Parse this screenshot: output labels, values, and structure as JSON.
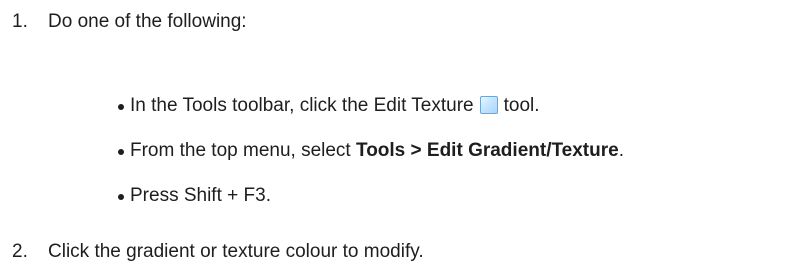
{
  "steps": [
    {
      "number": "1.",
      "text": "Do one of the following:",
      "bullets": [
        {
          "before": "In the Tools toolbar, click the Edit Texture",
          "icon": "edit-texture-tool-icon",
          "after": "tool."
        },
        {
          "before": "From the top menu, select ",
          "strong": "Tools > Edit Gradient/Texture",
          "after": "."
        },
        {
          "text": "Press Shift + F3."
        }
      ]
    },
    {
      "number": "2.",
      "text": "Click the gradient or texture colour to modify."
    }
  ],
  "colors": {
    "text": "#1e1e1e",
    "icon_border": "#6aa7d8",
    "icon_fill": "#bfe2ff"
  }
}
